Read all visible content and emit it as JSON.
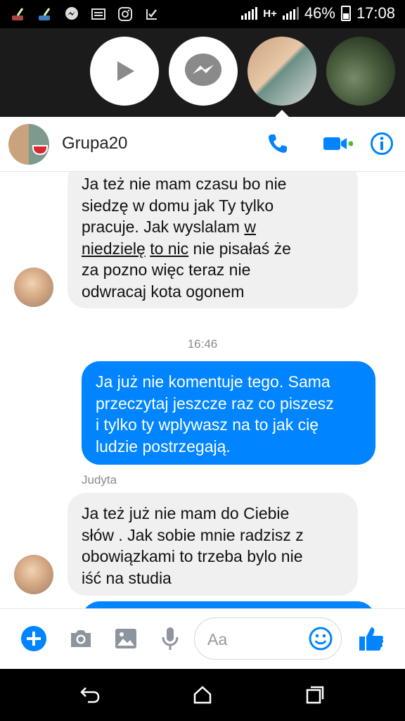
{
  "status_bar": {
    "icons": [
      "broom-icon",
      "broom-icon",
      "messenger-icon",
      "image-icon",
      "instagram-icon",
      "check-icon"
    ],
    "network": "H+",
    "battery": "46%",
    "time": "17:08"
  },
  "chat_heads": [
    {
      "name": "video-play-head",
      "icon": "play-icon"
    },
    {
      "name": "messenger-head",
      "icon": "messenger-icon"
    },
    {
      "name": "group-head",
      "icon": "group-photo"
    },
    {
      "name": "contact-head",
      "icon": "contact-photo"
    }
  ],
  "header": {
    "title": "Grupa20",
    "icons": [
      "phone-icon",
      "video-camera-icon",
      "info-icon"
    ],
    "active_color": "#0084ff",
    "online_color": "#44bd32"
  },
  "messages": {
    "m1": {
      "l1": "Ja też nie mam czasu bo nie",
      "l2": "siedzę w domu jak Ty tylko",
      "l3a": "pracuje.  Jak wyslalam ",
      "l3b": "w",
      "l4a": "niedzielę",
      "l4b": "to nic",
      "l4c": " nie pisałaś że",
      "l5": "za pozno więc teraz nie",
      "l6": "odwracaj kota ogonem"
    },
    "timestamp": "16:46",
    "m2": {
      "l1": "Ja już nie komentuje tego. Sama",
      "l2": "przeczytaj jeszcze raz co piszesz",
      "l3": "i tylko ty wplywasz na to jak cię",
      "l4": "ludzie postrzegają."
    },
    "sender": "Judyta",
    "m3": {
      "l1": "Ja też już nie mam do Ciebie",
      "l2": "słów . Jak sobie mnie radzisz z",
      "l3": "obowiązkami to trzeba bylo nie",
      "l4": "iść na studia"
    }
  },
  "composer": {
    "placeholder": "Aa",
    "icons": [
      "plus-icon",
      "camera-icon",
      "image-icon",
      "microphone-icon",
      "emoji-icon",
      "thumbs-up-icon"
    ]
  },
  "nav_bar": {
    "icons": [
      "back-icon",
      "home-icon",
      "recents-icon"
    ]
  }
}
